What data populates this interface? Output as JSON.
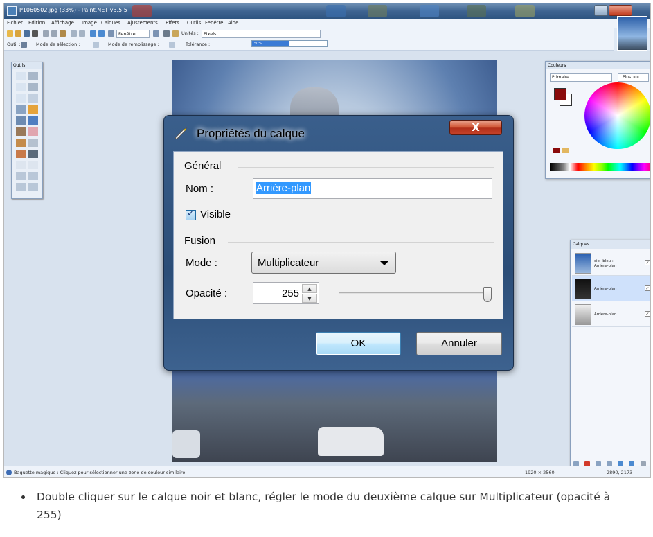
{
  "window": {
    "title": "P1060502.jpg (33%) - Paint.NET v3.5.5"
  },
  "menubar": {
    "items": [
      "Fichier",
      "Edition",
      "Affichage",
      "Image",
      "Calques",
      "Ajustements",
      "Effets",
      "Outils",
      "Fenêtre",
      "Aide"
    ]
  },
  "toolbar1": {
    "window_combo": "Fenêtre",
    "units_label": "Unités :",
    "units_value": "Pixels"
  },
  "toolbar2": {
    "tool_label": "Outil :",
    "selection_mode_label": "Mode de sélection :",
    "fill_mode_label": "Mode de remplissage :",
    "tolerance_label": "Tolérance :",
    "tolerance_value": "50%",
    "tolerance_fraction": 0.5
  },
  "panels": {
    "tools_title": "Outils",
    "colors_title": "Couleurs",
    "colors_primary": "Primaire",
    "colors_more": "Plus >>",
    "layers_title": "Calques",
    "layers": [
      {
        "name": "ciel_bleu :\nArrière-plan",
        "selected": false
      },
      {
        "name": "Arrière-plan",
        "selected": true
      },
      {
        "name": "Arrière-plan",
        "selected": false
      }
    ]
  },
  "statusbar": {
    "text": "Baguette magique : Cliquez pour sélectionner une zone de couleur similaire.",
    "image_size": "1920 × 2560",
    "coords": "2890, 2173"
  },
  "dialog": {
    "title": "Propriétés du calque",
    "close_label": "X",
    "general_group": "Général",
    "name_label": "Nom :",
    "name_value": "Arrière-plan",
    "visible_label": "Visible",
    "visible_checked": true,
    "fusion_group": "Fusion",
    "mode_label": "Mode :",
    "mode_value": "Multiplicateur",
    "opacity_label": "Opacité :",
    "opacity_value": "255",
    "opacity_fraction": 1.0,
    "ok_label": "OK",
    "cancel_label": "Annuler"
  },
  "caption": {
    "text": "Double cliquer sur le calque noir et blanc, régler le mode du deuxième calque sur Multiplicateur (opacité à 255)"
  },
  "colors": {
    "dialog_frame": "#2b4d77",
    "close_red": "#c7432a",
    "selection_blue": "#3399ff",
    "primary_color": "#8a0b0b"
  }
}
